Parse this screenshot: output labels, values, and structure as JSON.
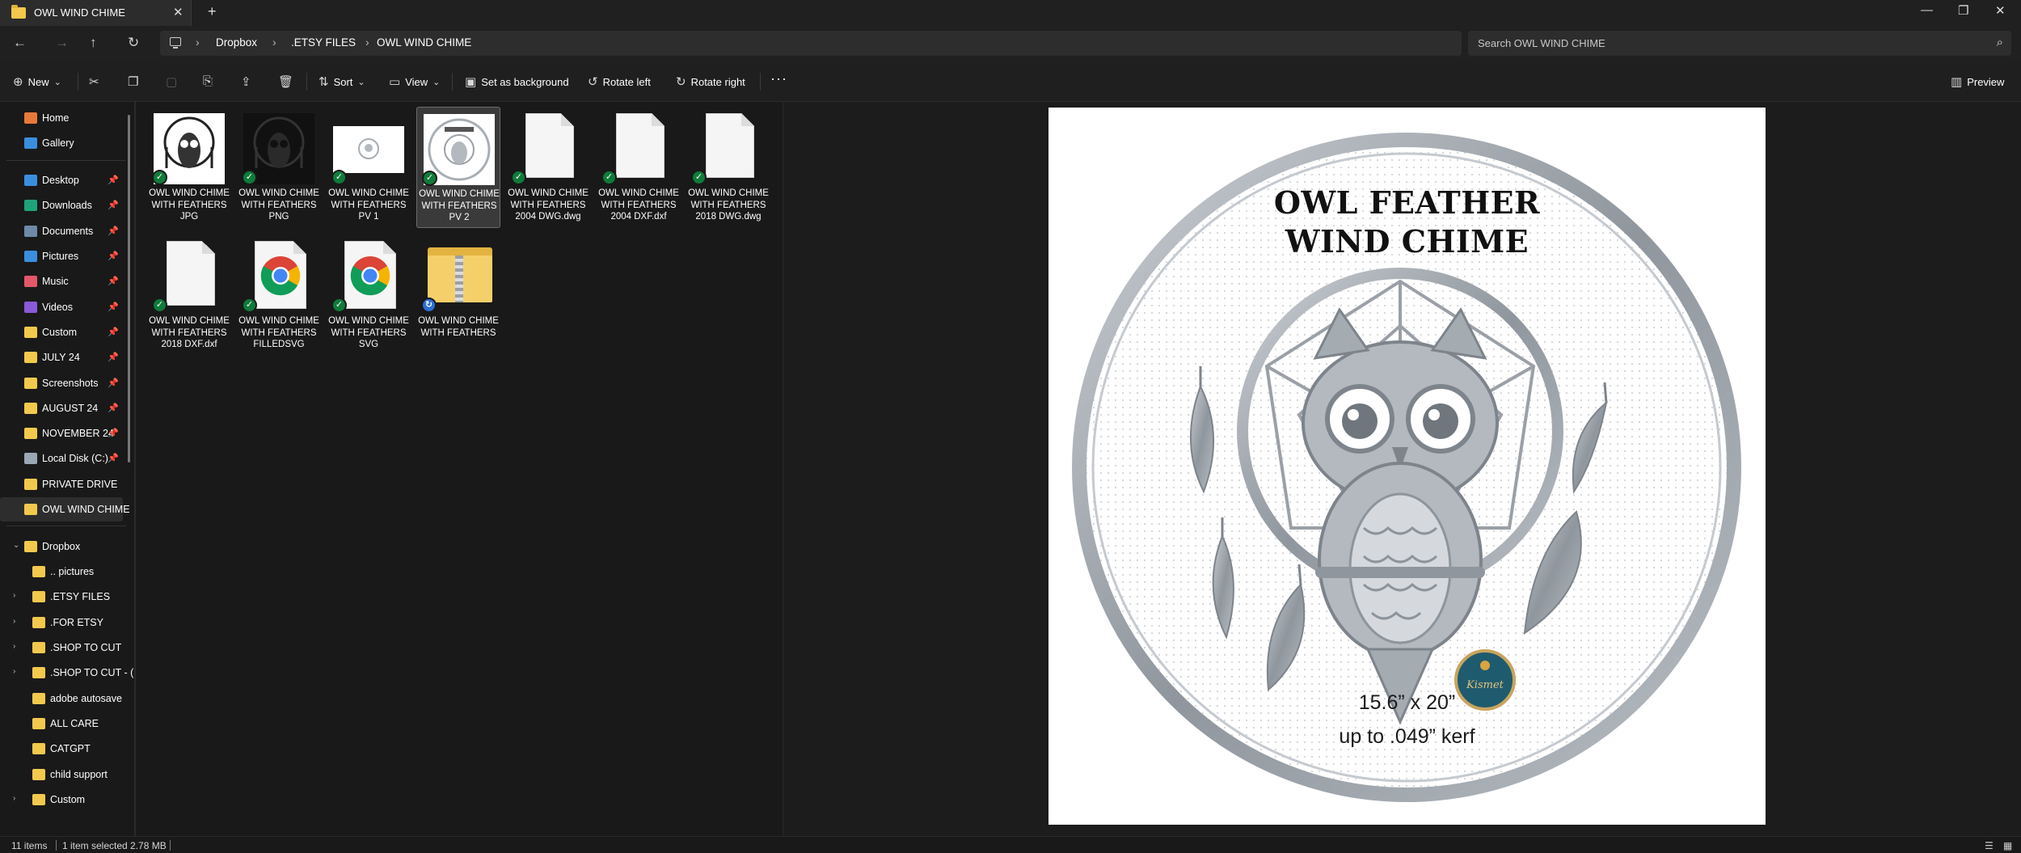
{
  "window": {
    "tab_title": "OWL WIND CHIME",
    "close_glyph": "✕",
    "new_tab_glyph": "+",
    "minimize_glyph": "—",
    "maximize_glyph": "❐",
    "window_close_glyph": "✕"
  },
  "nav": {
    "back_glyph": "←",
    "forward_glyph": "→",
    "up_glyph": "↑",
    "refresh_glyph": "↻",
    "breadcrumbs": [
      "Dropbox",
      ".ETSY FILES",
      "OWL WIND CHIME"
    ],
    "separator": "›",
    "search_placeholder": "Search OWL WIND CHIME",
    "search_glyph": "⌕"
  },
  "commands": {
    "new": "New",
    "sort": "Sort",
    "view": "View",
    "set_background": "Set as background",
    "rotate_left": "Rotate left",
    "rotate_right": "Rotate right",
    "more": "···",
    "preview": "Preview",
    "cut_glyph": "✂",
    "copy_glyph": "❐",
    "paste_glyph": "▢",
    "rename_glyph": "⎘",
    "share_glyph": "⇪",
    "delete_glyph": "🗑",
    "new_glyph": "⊕",
    "sort_glyph": "⇅",
    "view_glyph": "▭",
    "bg_glyph": "▣",
    "rotl_glyph": "↺",
    "rotr_glyph": "↻",
    "preview_glyph": "▥",
    "dropdown_glyph": "⌄"
  },
  "sidebar": {
    "pin_glyph": "📌",
    "expand_glyph": "›",
    "collapse_glyph": "⌄",
    "quick": [
      {
        "label": "Home",
        "icon": "home-icon",
        "color": "#e8793a"
      },
      {
        "label": "Gallery",
        "icon": "gallery-icon",
        "color": "#3b8ede"
      }
    ],
    "pinned": [
      {
        "label": "Desktop",
        "icon": "desktop-icon",
        "color": "#3b8ede"
      },
      {
        "label": "Downloads",
        "icon": "downloads-icon",
        "color": "#1fa37a"
      },
      {
        "label": "Documents",
        "icon": "documents-icon",
        "color": "#6f8aa8"
      },
      {
        "label": "Pictures",
        "icon": "pictures-icon",
        "color": "#3b8ede"
      },
      {
        "label": "Music",
        "icon": "music-icon",
        "color": "#e4576a"
      },
      {
        "label": "Videos",
        "icon": "videos-icon",
        "color": "#8a5ad9"
      },
      {
        "label": "Custom",
        "icon": "folder-icon",
        "color": "#f2c94c"
      },
      {
        "label": "JULY 24",
        "icon": "folder-icon",
        "color": "#f2c94c"
      },
      {
        "label": "Screenshots",
        "icon": "folder-icon",
        "color": "#f2c94c"
      },
      {
        "label": "AUGUST 24",
        "icon": "folder-icon",
        "color": "#f2c94c"
      },
      {
        "label": "NOVEMBER 24",
        "icon": "folder-icon",
        "color": "#f2c94c"
      },
      {
        "label": "Local Disk (C:)",
        "icon": "drive-icon",
        "color": "#9aa7b4"
      },
      {
        "label": "PRIVATE DRIVE",
        "icon": "folder-icon",
        "color": "#f2c94c"
      },
      {
        "label": "OWL WIND CHIME",
        "icon": "folder-icon",
        "color": "#f2c94c"
      }
    ],
    "dropbox_label": "Dropbox",
    "dropbox_children": [
      {
        "label": ".. pictures"
      },
      {
        "label": ".ETSY FILES"
      },
      {
        "label": ".FOR ETSY"
      },
      {
        "label": ".SHOP TO CUT"
      },
      {
        "label": ".SHOP TO CUT - ("
      },
      {
        "label": "adobe autosave"
      },
      {
        "label": "ALL CARE"
      },
      {
        "label": "CATGPT"
      },
      {
        "label": "child support"
      },
      {
        "label": "Custom"
      }
    ]
  },
  "files": [
    {
      "name": "OWL WIND CHIME WITH FEATHERS  JPG",
      "kind": "image-owl",
      "status": "synced"
    },
    {
      "name": "OWL WIND CHIME WITH FEATHERS  PNG",
      "kind": "image-owl-dark",
      "status": "synced"
    },
    {
      "name": "OWL WIND CHIME WITH FEATHERS  PV 1",
      "kind": "image-wide",
      "status": "synced"
    },
    {
      "name": "OWL WIND CHIME WITH FEATHERS  PV 2",
      "kind": "image-round",
      "status": "synced",
      "selected": true
    },
    {
      "name": "OWL WIND CHIME WITH FEATHERS 2004 DWG.dwg",
      "kind": "doc",
      "status": "synced"
    },
    {
      "name": "OWL WIND CHIME WITH FEATHERS 2004 DXF.dxf",
      "kind": "doc",
      "status": "synced"
    },
    {
      "name": "OWL WIND CHIME WITH FEATHERS 2018 DWG.dwg",
      "kind": "doc",
      "status": "synced"
    },
    {
      "name": "OWL WIND CHIME WITH FEATHERS 2018 DXF.dxf",
      "kind": "doc",
      "status": "synced"
    },
    {
      "name": "OWL WIND CHIME WITH FEATHERS FILLEDSVG",
      "kind": "chrome",
      "status": "synced"
    },
    {
      "name": "OWL WIND CHIME WITH FEATHERS SVG",
      "kind": "chrome",
      "status": "synced"
    },
    {
      "name": "OWL WIND CHIME WITH FEATHERS",
      "kind": "zip",
      "status": "syncing"
    }
  ],
  "preview": {
    "title_line1": "OWL FEATHER",
    "title_line2": "WIND CHIME",
    "dimensions": "15.6” x 20”",
    "kerf": "up to .049” kerf",
    "badge_text": "Kismet"
  },
  "status": {
    "items": "11 items",
    "selected": "1 item selected  2.78 MB",
    "details_glyph": "☰",
    "tiles_glyph": "▦"
  },
  "colors": {
    "sync_green": "#0f7b3a",
    "sync_blue": "#2e6fd8",
    "folder_yellow": "#f2c94c",
    "metal": "#a7adb3"
  }
}
